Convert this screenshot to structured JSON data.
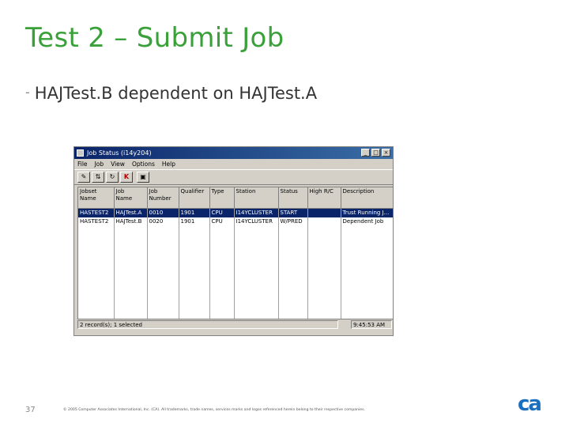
{
  "slide": {
    "title": "Test 2 – Submit Job",
    "bullet": "HAJTest.B dependent on HAJTest.A",
    "page_number": "37",
    "copyright": "© 2005 Computer Associates International, Inc. (CA). All trademarks, trade names, services marks and logos referenced herein belong to their respective companies.",
    "logo_text": "ca"
  },
  "window": {
    "title": "Job Status (i14y204)",
    "controls": [
      "_",
      "□",
      "×"
    ],
    "menu": [
      "File",
      "Job",
      "View",
      "Options",
      "Help"
    ],
    "toolbar_icons": [
      "tool-1-icon",
      "tool-2-icon",
      "tool-3-icon",
      "kill-icon",
      "tool-5-icon"
    ],
    "toolbar_glyphs": [
      "✎",
      "⇅",
      "↻",
      "K",
      "▣"
    ],
    "columns": [
      "Jobset\nName",
      "Job\nName",
      "Job\nNumber",
      "Qualifier",
      "Type",
      "Station",
      "Status",
      "High R/C",
      "Description"
    ],
    "rows": [
      [
        "HASTEST2",
        "HAJTest.A",
        "0010",
        "1901",
        "CPU",
        "I14YCLUSTER",
        "START",
        "",
        "Trust Running J..."
      ],
      [
        "HASTEST2",
        "HAJTest.B",
        "0020",
        "1901",
        "CPU",
        "I14YCLUSTER",
        "W/PRED",
        "",
        "Dependent Job"
      ]
    ],
    "status_left": "2 record(s); 1 selected",
    "status_right": "9:45:53 AM"
  }
}
